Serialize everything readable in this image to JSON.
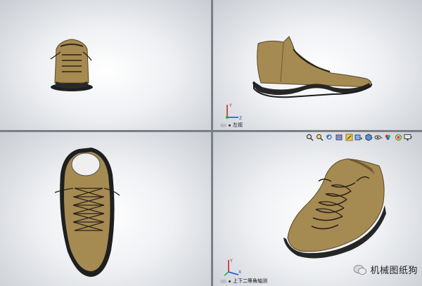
{
  "viewports": {
    "front": {
      "label": ""
    },
    "left": {
      "label": "左视"
    },
    "top": {
      "label": ""
    },
    "iso": {
      "label": "上下二等角轴测"
    }
  },
  "triad": {
    "x": "X",
    "y": "Y",
    "z": "Z"
  },
  "toolbar": {
    "icons": [
      "magnify-icon",
      "zoom-area-icon",
      "previous-view-icon",
      "section-view-icon",
      "dynamic-annotation-icon",
      "view-orientation-icon",
      "display-style-icon",
      "hide-show-icon",
      "edit-appearance-icon",
      "scene-icon",
      "display-settings-icon"
    ]
  },
  "watermark": {
    "text": "机械图纸狗"
  },
  "colors": {
    "shoe_upper": "#a58a52",
    "shoe_upper_dark": "#6f5a30",
    "sole": "#262626",
    "lace": "#2b2117",
    "viewport_bg": "#eef0f3",
    "divider": "#7a7f86"
  }
}
